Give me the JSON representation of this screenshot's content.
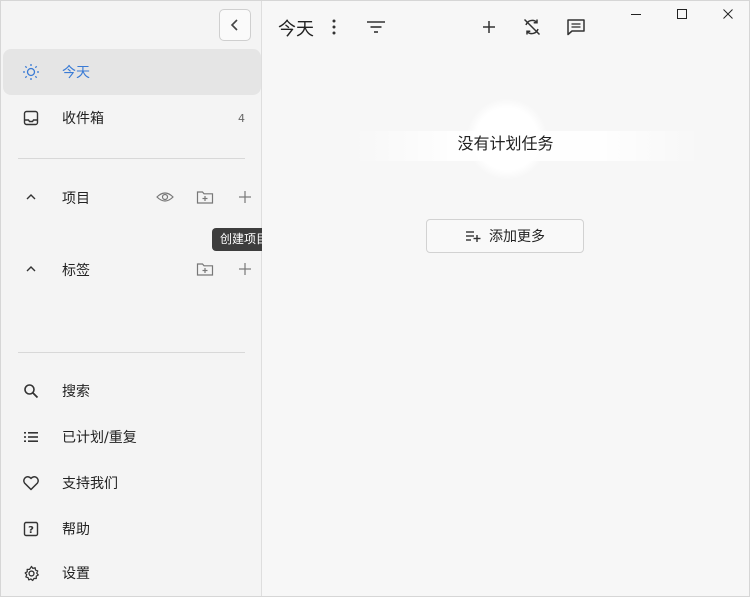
{
  "sidebar": {
    "nav": [
      {
        "label": "今天",
        "icon": "sun-icon",
        "active": true
      },
      {
        "label": "收件箱",
        "icon": "inbox-icon",
        "count": "4"
      }
    ],
    "projects": {
      "label": "项目",
      "tooltip": "创建项目"
    },
    "tags": {
      "label": "标签"
    },
    "bottom": [
      {
        "label": "搜索",
        "icon": "search-icon"
      },
      {
        "label": "已计划/重复",
        "icon": "list-icon"
      },
      {
        "label": "支持我们",
        "icon": "heart-icon"
      },
      {
        "label": "帮助",
        "icon": "help-icon"
      },
      {
        "label": "设置",
        "icon": "gear-icon"
      }
    ]
  },
  "main": {
    "title": "今天",
    "empty_text": "没有计划任务",
    "add_more_label": "添加更多"
  },
  "colors": {
    "accent": "#3a7bd5",
    "active_bg": "#e5e5e5"
  }
}
